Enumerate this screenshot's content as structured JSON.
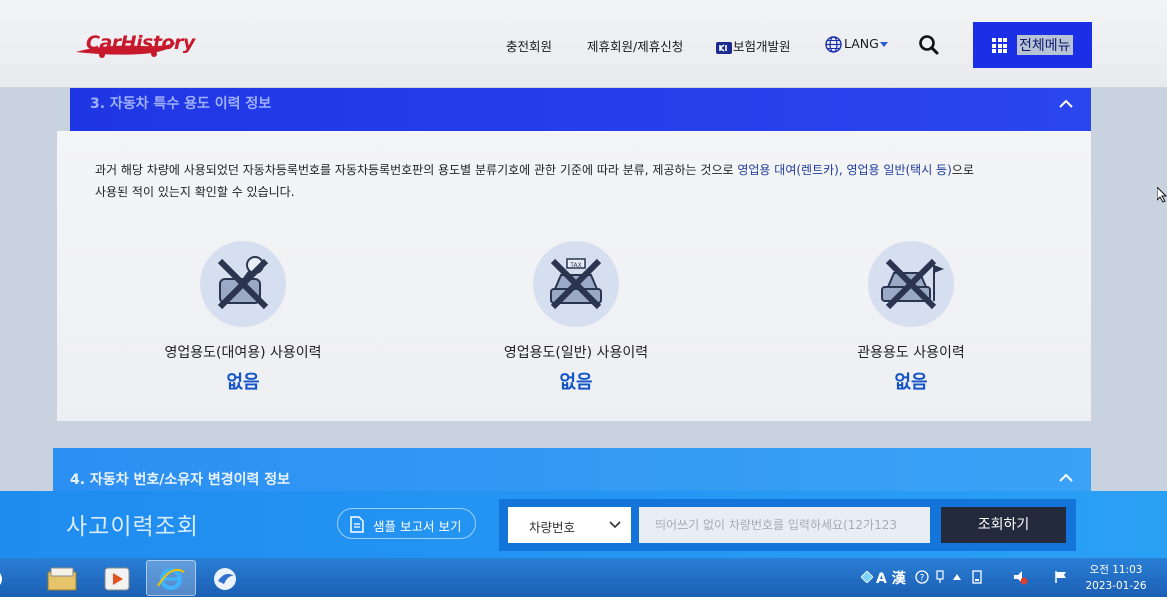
{
  "header": {
    "logo_text": "CarHistory",
    "nav": [
      {
        "label": "충전회원"
      },
      {
        "label": "제휴회원/제휴신청"
      },
      {
        "label": "보험개발원"
      },
      {
        "label": "LANG"
      }
    ],
    "menu_label": "전체메뉴"
  },
  "section3": {
    "title": "3. 자동차 특수 용도 이력 정보",
    "description_line1_pre": "과거 해당 차량에 사용되었던 자동차등록번호를 자동차등록번호판의 용도별 분류기호에 관한 기준에 따라 분류, 제공하는 것으로 ",
    "description_line1_em": "영업용 대여(렌트카), 영업용 일반(택시 등)",
    "description_line1_post": "으로",
    "description_line2": "사용된 적이 있는지 확인할 수 있습니다.",
    "cards": [
      {
        "label": "영업용도(대여용) 사용이력",
        "value": "없음",
        "icon": "rental-car-key-icon"
      },
      {
        "label": "영업용도(일반) 사용이력",
        "value": "없음",
        "icon": "taxi-icon"
      },
      {
        "label": "관용용도 사용이력",
        "value": "없음",
        "icon": "government-car-icon"
      }
    ]
  },
  "section4": {
    "title": "4. 자동차 번호/소유자 변경이력 정보"
  },
  "search_bar": {
    "title": "사고이력조회",
    "sample_button": "샘플 보고서 보기",
    "select_value": "차량번호",
    "input_placeholder": "띄어쓰기 없이 차량번호를 입력하세요(12가123",
    "submit_label": "조회하기"
  },
  "taskbar": {
    "ime_label": "A 漢",
    "clock_time": "오전 11:03",
    "clock_date": "2023-01-26"
  },
  "colors": {
    "primary_blue": "#1f36e4",
    "accent_blue": "#2c8ff2",
    "value_blue": "#1454c9",
    "logo_red": "#c8192c"
  }
}
